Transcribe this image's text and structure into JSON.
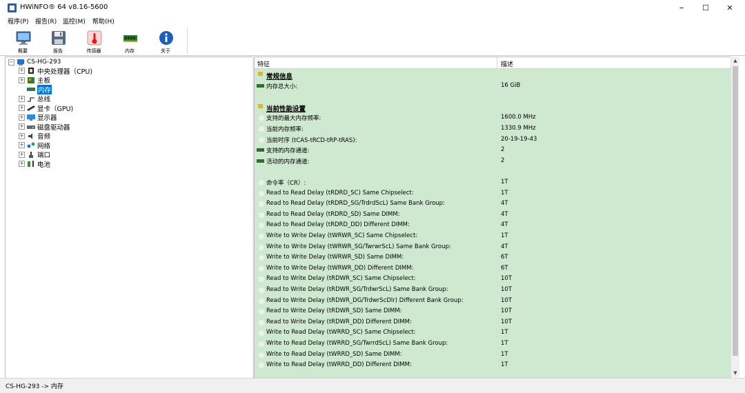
{
  "window": {
    "title": "HWiNFO® 64 v8.16-5600",
    "minimize": "–",
    "maximize": "☐",
    "close": "✕"
  },
  "menu": [
    "程序(P)",
    "报告(R)",
    "监控(M)",
    "帮助(H)"
  ],
  "toolbar": [
    {
      "label": "概要",
      "icon": "monitor-icon"
    },
    {
      "label": "报告",
      "icon": "save-icon"
    },
    {
      "label": "传感器",
      "icon": "thermometer-icon"
    },
    {
      "label": "内存",
      "icon": "memory-icon"
    },
    {
      "label": "关于",
      "icon": "info-icon"
    }
  ],
  "tree": {
    "root": "CS-HG-293",
    "items": [
      {
        "label": "中央处理器（CPU)",
        "icon": "cpu-icon",
        "expander": "+"
      },
      {
        "label": "主板",
        "icon": "motherboard-icon",
        "expander": "+"
      },
      {
        "label": "内存",
        "icon": "memory-icon",
        "expander": "",
        "selected": true
      },
      {
        "label": "总线",
        "icon": "bus-icon",
        "expander": "+"
      },
      {
        "label": "显卡（GPU)",
        "icon": "gpu-icon",
        "expander": "+"
      },
      {
        "label": "显示器",
        "icon": "display-icon",
        "expander": "+"
      },
      {
        "label": "磁盘驱动器",
        "icon": "disk-icon",
        "expander": "+"
      },
      {
        "label": "音频",
        "icon": "audio-icon",
        "expander": "+"
      },
      {
        "label": "网络",
        "icon": "network-icon",
        "expander": "+"
      },
      {
        "label": "端口",
        "icon": "port-icon",
        "expander": "+"
      },
      {
        "label": "电池",
        "icon": "battery-icon",
        "expander": "+"
      }
    ]
  },
  "list": {
    "header": {
      "feature": "特征",
      "description": "描述"
    },
    "rows": [
      {
        "type": "section",
        "feature": "常规信息",
        "value": ""
      },
      {
        "type": "ram",
        "feature": "内存总大小:",
        "value": "16 GiB"
      },
      {
        "type": "blank",
        "feature": "",
        "value": ""
      },
      {
        "type": "section",
        "feature": "当前性能设置",
        "value": ""
      },
      {
        "type": "dot",
        "feature": "支持的最大内存频率:",
        "value": "1600.0 MHz"
      },
      {
        "type": "dot",
        "feature": "当前内存频率:",
        "value": "1330.9 MHz"
      },
      {
        "type": "dot",
        "feature": "当前时序 (tCAS-tRCD-tRP-tRAS):",
        "value": "20-19-19-43"
      },
      {
        "type": "ram",
        "feature": "支持的内存通道:",
        "value": "2"
      },
      {
        "type": "ram",
        "feature": "活动的内存通道:",
        "value": "2"
      },
      {
        "type": "blank",
        "feature": "",
        "value": ""
      },
      {
        "type": "dot",
        "feature": "命令率（CR）:",
        "value": "1T"
      },
      {
        "type": "dot",
        "feature": "Read to Read Delay (tRDRD_SC) Same Chipselect:",
        "value": "1T"
      },
      {
        "type": "dot",
        "feature": "Read to Read Delay (tRDRD_SG/TrdrdScL) Same Bank Group:",
        "value": "4T"
      },
      {
        "type": "dot",
        "feature": "Read to Read Delay (tRDRD_SD) Same DIMM:",
        "value": "4T"
      },
      {
        "type": "dot",
        "feature": "Read to Read Delay (tRDRD_DD) Different DIMM:",
        "value": "4T"
      },
      {
        "type": "dot",
        "feature": "Write to Write Delay (tWRWR_SC) Same Chipselect:",
        "value": "1T"
      },
      {
        "type": "dot",
        "feature": "Write to Write Delay (tWRWR_SG/TwrwrScL) Same Bank Group:",
        "value": "4T"
      },
      {
        "type": "dot",
        "feature": "Write to Write Delay (tWRWR_SD) Same DIMM:",
        "value": "6T"
      },
      {
        "type": "dot",
        "feature": "Write to Write Delay (tWRWR_DD) Different DIMM:",
        "value": "6T"
      },
      {
        "type": "dot",
        "feature": "Read to Write Delay (tRDWR_SC) Same Chipselect:",
        "value": "10T"
      },
      {
        "type": "dot",
        "feature": "Read to Write Delay (tRDWR_SG/TrdwrScL) Same Bank Group:",
        "value": "10T"
      },
      {
        "type": "dot",
        "feature": "Read to Write Delay (tRDWR_DG/TrdwrScDlr) Different Bank Group:",
        "value": "10T"
      },
      {
        "type": "dot",
        "feature": "Read to Write Delay (tRDWR_SD) Same DIMM:",
        "value": "10T"
      },
      {
        "type": "dot",
        "feature": "Read to Write Delay (tRDWR_DD) Different DIMM:",
        "value": "10T"
      },
      {
        "type": "dot",
        "feature": "Write to Read Delay (tWRRD_SC) Same Chipselect:",
        "value": "1T"
      },
      {
        "type": "dot",
        "feature": "Write to Read Delay (tWRRD_SG/TwrrdScL) Same Bank Group:",
        "value": "1T"
      },
      {
        "type": "dot",
        "feature": "Write to Read Delay (tWRRD_SD) Same DIMM:",
        "value": "1T"
      },
      {
        "type": "dot",
        "feature": "Write to Read Delay (tWRRD_DD) Different DIMM:",
        "value": "1T"
      }
    ]
  },
  "status": {
    "text": "CS-HG-293 -> 内存"
  }
}
